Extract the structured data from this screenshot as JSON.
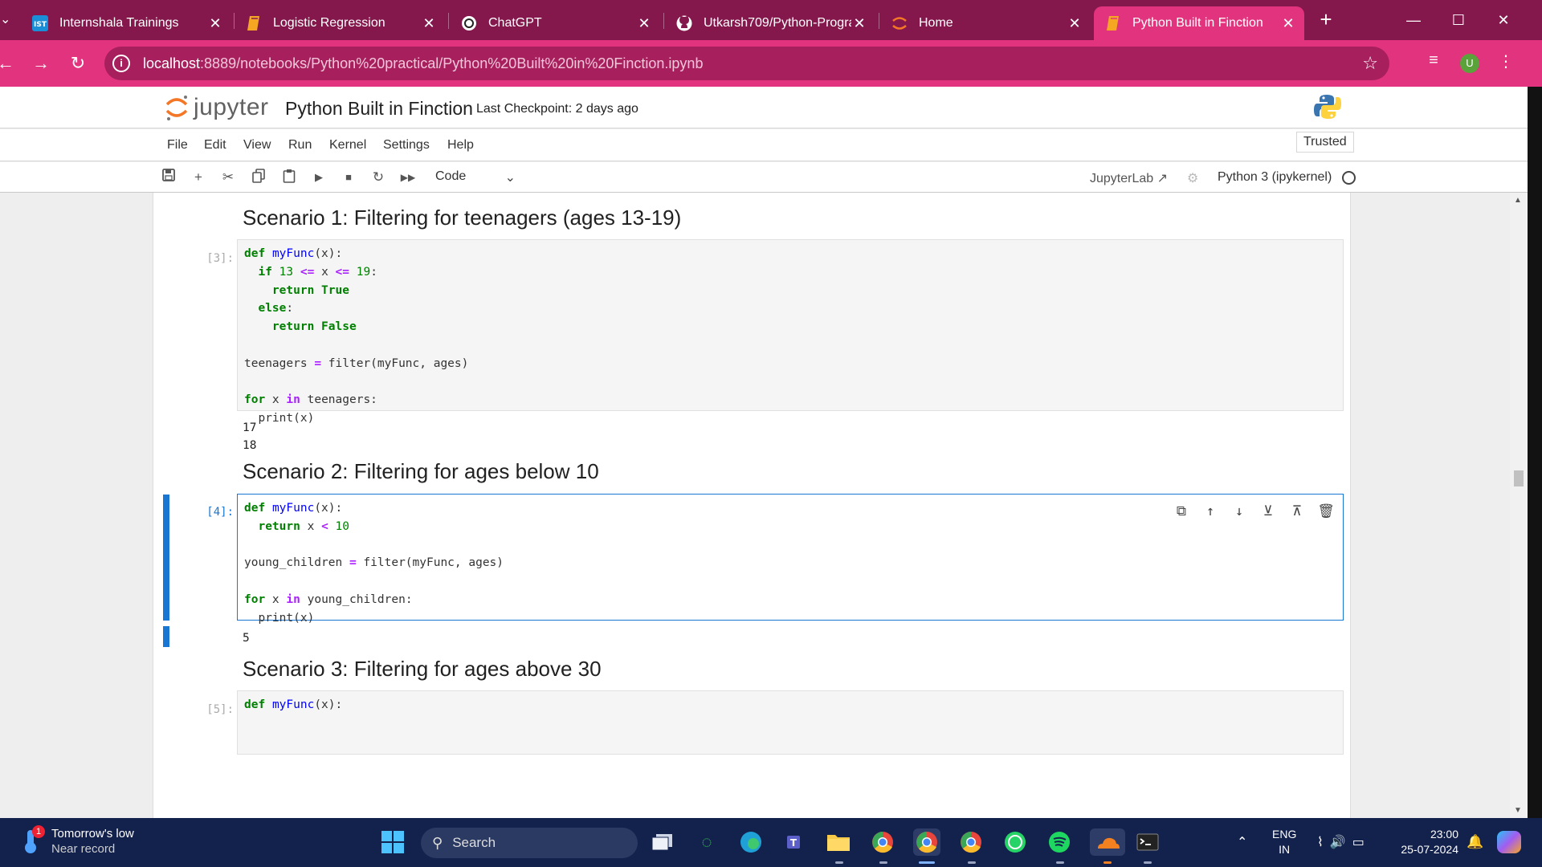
{
  "browser": {
    "tabs": [
      {
        "title": "Internshala Trainings",
        "icon": "internshala-icon",
        "active": false
      },
      {
        "title": "Logistic Regression",
        "icon": "notebook-icon",
        "active": false
      },
      {
        "title": "ChatGPT",
        "icon": "chatgpt-icon",
        "active": false
      },
      {
        "title": "Utkarsh709/Python-Progra",
        "icon": "github-icon",
        "active": false
      },
      {
        "title": "Home",
        "icon": "jupyter-icon",
        "active": false
      },
      {
        "title": "Python Built in Finction",
        "icon": "notebook-icon",
        "active": true
      }
    ],
    "url_host": "localhost",
    "url_path": ":8889/notebooks/Python%20practical/Python%20Built%20in%20Finction.ipynb",
    "profile_initial": "U",
    "colors": {
      "tabbar": "#84184d",
      "active_tab": "#e2337e",
      "toolbar": "#e2337e"
    }
  },
  "jupyter": {
    "logo_text": "jupyter",
    "notebook_title": "Python Built in Finction",
    "checkpoint": "Last Checkpoint: 2 days ago",
    "menu": [
      "File",
      "Edit",
      "View",
      "Run",
      "Kernel",
      "Settings",
      "Help"
    ],
    "trusted": "Trusted",
    "cell_type": "Code",
    "jupyterlab_link": "JupyterLab",
    "kernel": "Python 3 (ipykernel)"
  },
  "cells": {
    "heading1": "Scenario 1: Filtering for teenagers (ages 13-19)",
    "cell3_prompt": "[3]:",
    "cell3_output": "17\n18",
    "heading2": "Scenario 2: Filtering for ages below 10",
    "cell4_prompt": "[4]:",
    "cell4_output": "5",
    "heading3": "Scenario 3: Filtering for ages above 30",
    "cell5_prompt": "[5]:"
  },
  "taskbar": {
    "weather_title": "Tomorrow's low",
    "weather_sub": "Near record",
    "weather_badge": "1",
    "search_placeholder": "Search",
    "lang_line1": "ENG",
    "lang_line2": "IN",
    "time": "23:00",
    "date": "25-07-2024"
  }
}
